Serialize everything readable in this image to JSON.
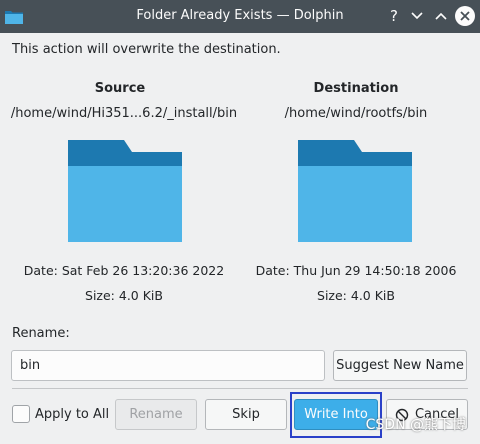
{
  "window": {
    "title": "Folder Already Exists — Dolphin",
    "help_glyph": "?"
  },
  "message": "This action will overwrite the destination.",
  "source": {
    "heading": "Source",
    "path": "/home/wind/Hi351...6.2/_install/bin",
    "date": "Date: Sat Feb 26 13:20:36 2022",
    "size": "Size: 4.0 KiB"
  },
  "destination": {
    "heading": "Destination",
    "path": "/home/wind/rootfs/bin",
    "date": "Date: Thu Jun 29 14:50:18 2006",
    "size": "Size: 4.0 KiB"
  },
  "rename": {
    "label": "Rename:",
    "value": "bin",
    "suggest_label": "Suggest New Name"
  },
  "buttons": {
    "apply_to_all": "Apply to All",
    "rename": "Rename",
    "skip": "Skip",
    "write_into": "Write Into",
    "cancel": "Cancel"
  },
  "icons": {
    "titlebar": "dolphin-folder-icon",
    "folder": "folder-icon",
    "cancel": "cancel-icon"
  },
  "colors": {
    "titlebar": "#475057",
    "folder_front": "#4fb5e8",
    "folder_back": "#1d79b0",
    "accent": "#3daee9"
  },
  "watermark": "CSDN @熊下博"
}
